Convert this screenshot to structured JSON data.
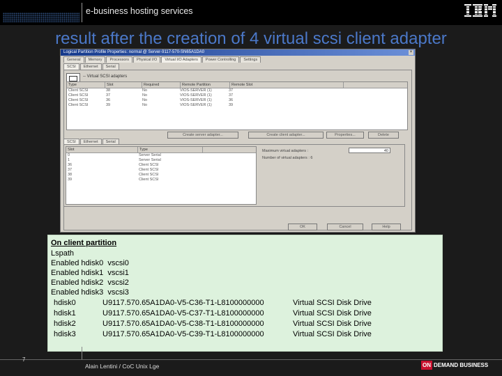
{
  "header": {
    "title": "e-business hosting services"
  },
  "slide": {
    "title": "result after the creation of 4 virtual scsi client adapter"
  },
  "dialog": {
    "window_title": "Logical Partition Profile Properties: normal @ Server-9117-570-SN65A1DA0",
    "tabs_row1": [
      "General",
      "Memory",
      "Processors",
      "Physical I/O",
      "Virtual I/O Adapters",
      "Power Controlling",
      "Settings"
    ],
    "tabs_row2": [
      "SCSI",
      "Ethernet",
      "Serial"
    ],
    "section_label": "-- Virtual SCSI adapters",
    "columns": [
      "Type",
      "Slot",
      "Required",
      "Remote Partition",
      "Remote Slot"
    ],
    "rows": [
      [
        "Client SCSI",
        "38",
        "No",
        "VIOS-SERVER (1)",
        "37"
      ],
      [
        "Client SCSI",
        "37",
        "No",
        "VIOS-SERVER (1)",
        "37"
      ],
      [
        "Client SCSI",
        "36",
        "No",
        "VIOS-SERVER (1)",
        "36"
      ],
      [
        "Client SCSI",
        "39",
        "No",
        "VIOS-SERVER (1)",
        "39"
      ]
    ],
    "buttons": [
      "Create server adapter...",
      "Create client adapter...",
      "Properties...",
      "Delete"
    ],
    "tabs_row3": [
      "SCSI",
      "Ethernet",
      "Serial"
    ],
    "list_columns": [
      "Slot",
      "Type"
    ],
    "list_rows": [
      [
        "0",
        "Server Serial"
      ],
      [
        "1",
        "Server Serial"
      ],
      [
        "36",
        "Client SCSI"
      ],
      [
        "37",
        "Client SCSI"
      ],
      [
        "38",
        "Client SCSI"
      ],
      [
        "39",
        "Client SCSI"
      ]
    ],
    "max_label": "Maximum virtual adapters :",
    "max_value": "40",
    "num_label": "Number of virtual adapters : 6",
    "footer_buttons": [
      "OK",
      "Cancel",
      "Help"
    ]
  },
  "output": {
    "heading": "On client partition",
    "lines": [
      "Lspath",
      "Enabled hdisk0  vscsi0",
      "Enabled hdisk1  vscsi1",
      "Enabled hdisk2  vscsi2",
      "Enabled hdisk3  vscsi3"
    ],
    "disks": [
      {
        "name": "hdisk0",
        "location": "U9117.570.65A1DA0-V5-C36-T1-L8100000000",
        "desc": "Virtual SCSI Disk Drive"
      },
      {
        "name": "hdisk1",
        "location": "U9117.570.65A1DA0-V5-C37-T1-L8100000000",
        "desc": "Virtual SCSI Disk Drive"
      },
      {
        "name": "hdisk2",
        "location": "U9117.570.65A1DA0-V5-C38-T1-L8100000000",
        "desc": "Virtual SCSI Disk Drive"
      },
      {
        "name": "hdisk3",
        "location": "U9117.570.65A1DA0-V5-C39-T1-L8100000000",
        "desc": "Virtual SCSI Disk Drive"
      }
    ]
  },
  "footer": {
    "page_number": "7",
    "author": "Alain Lentini / CoC Unix Lge",
    "badge_on": "ON",
    "badge_text": "DEMAND BUSINESS"
  },
  "colors": {
    "title": "#4b78c8",
    "output_bg": "#ddf2dd",
    "badge_red": "#c8102e"
  }
}
